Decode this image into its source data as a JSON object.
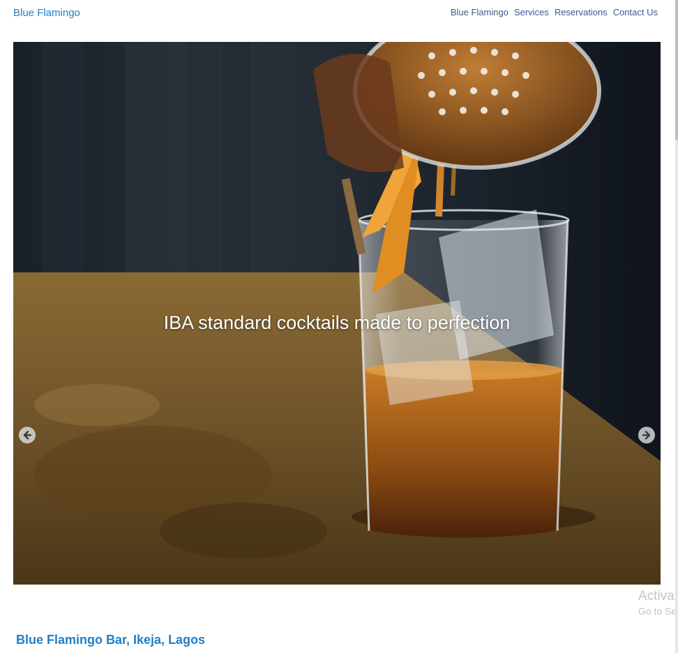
{
  "header": {
    "brand": "Blue Flamingo",
    "nav": [
      "Blue Flamingo",
      "Services",
      "Reservations",
      "Contact Us"
    ]
  },
  "hero": {
    "caption": "IBA standard cocktails made to perfection",
    "prev_icon": "arrow-left-circle-icon",
    "next_icon": "arrow-right-circle-icon"
  },
  "section": {
    "title": "Blue Flamingo Bar, Ikeja, Lagos"
  },
  "watermark": {
    "line1": "Activat",
    "line2": "Go to Se"
  },
  "colors": {
    "brand": "#1f7fc8",
    "nav": "#3b5b8f",
    "background": "#ffffff"
  }
}
